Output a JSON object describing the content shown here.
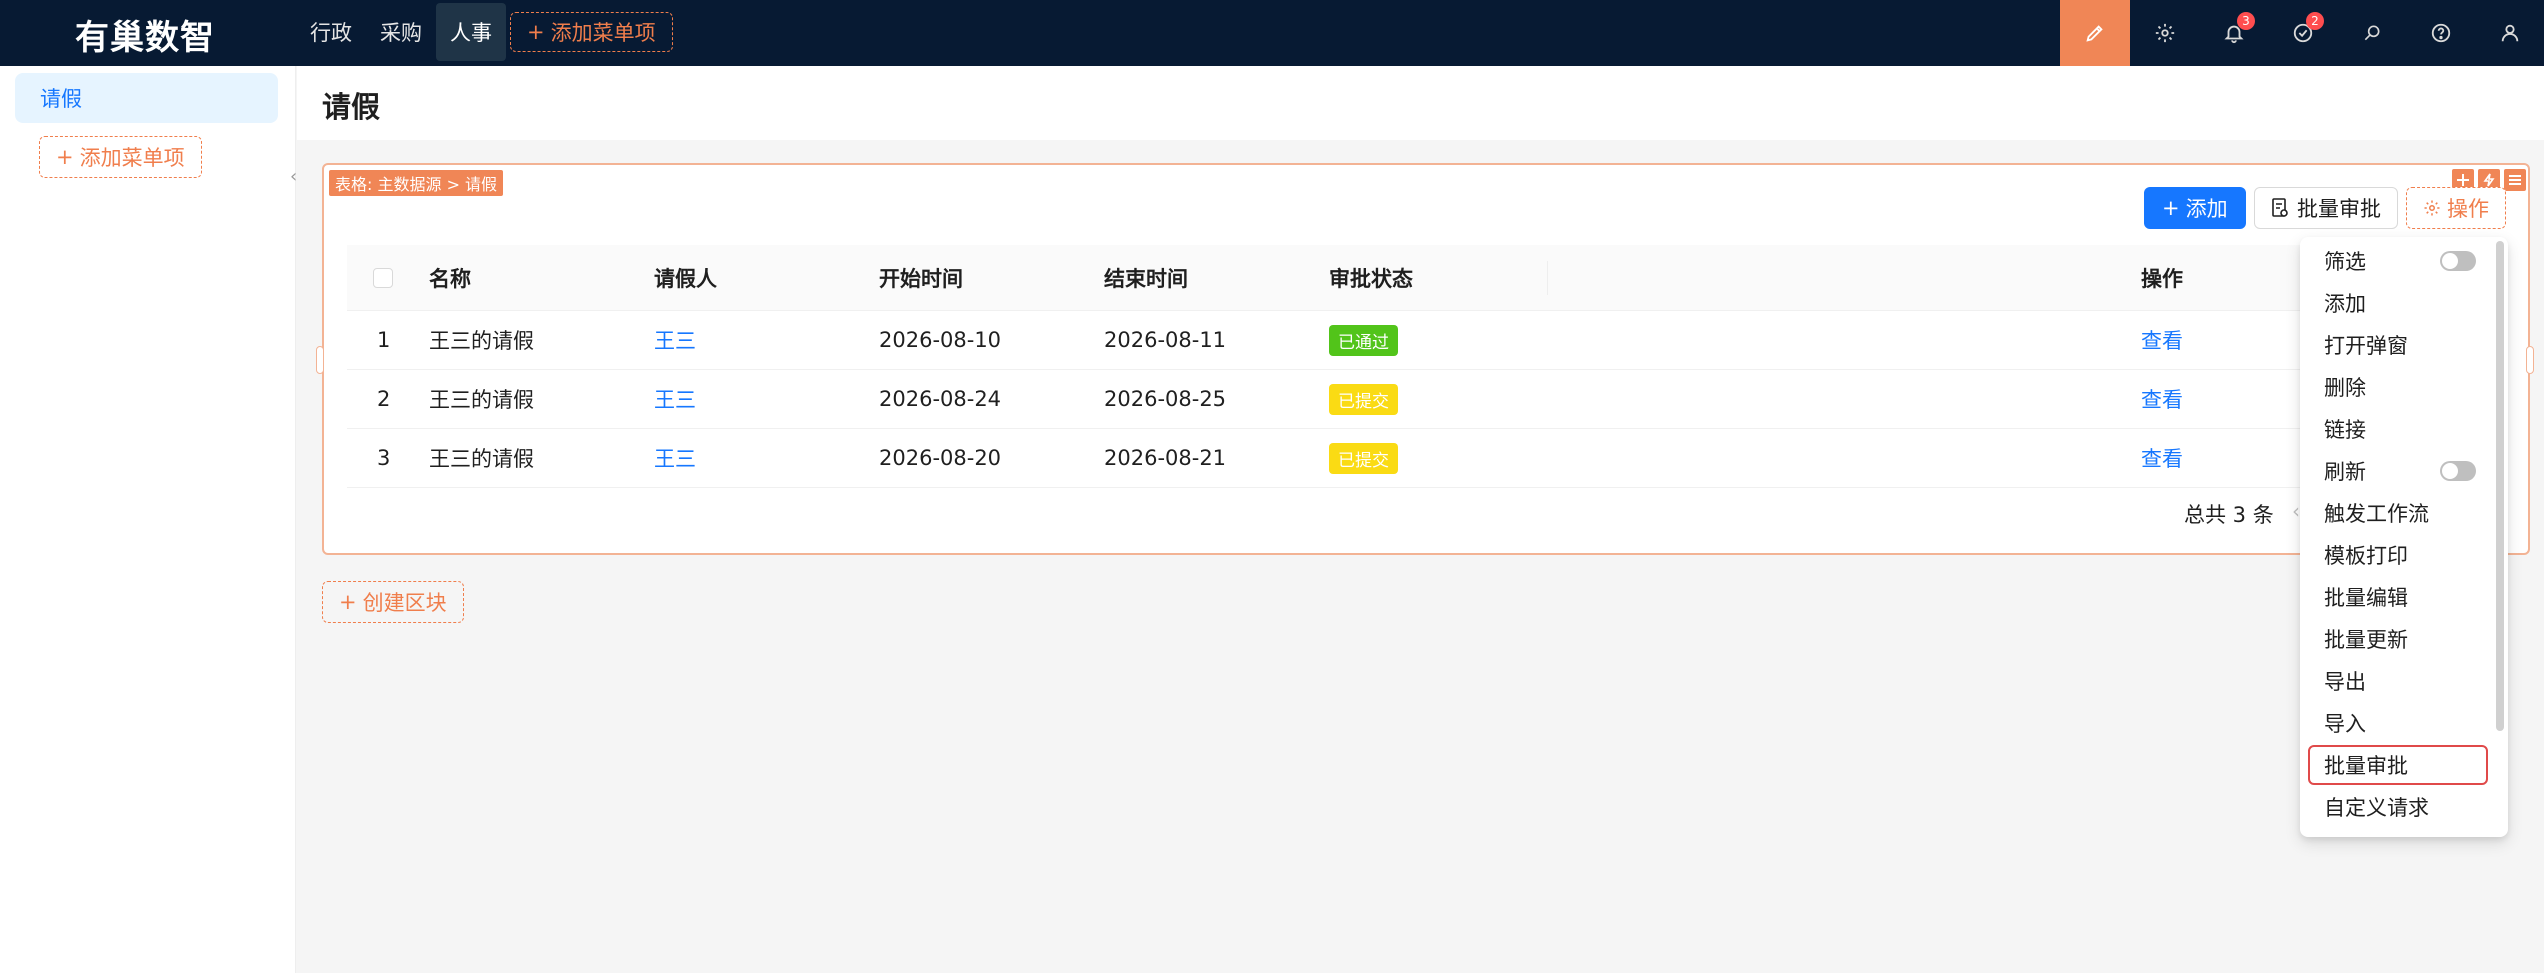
{
  "app": {
    "logo": "有巢数智"
  },
  "topnav": {
    "items": [
      {
        "label": "行政"
      },
      {
        "label": "采购"
      },
      {
        "label": "人事",
        "active": true
      }
    ],
    "add_menu": "添加菜单项"
  },
  "top_actions": {
    "notifications_badge": "3",
    "tasks_badge": "2"
  },
  "sidebar": {
    "items": [
      {
        "label": "请假",
        "active": true
      }
    ],
    "add_menu": "添加菜单项"
  },
  "page": {
    "title": "请假"
  },
  "block": {
    "tag": "表格: 主数据源 > 请假",
    "add_button": "添加",
    "batch_button": "批量审批",
    "ops_button": "操作"
  },
  "table": {
    "columns": [
      "名称",
      "请假人",
      "开始时间",
      "结束时间",
      "审批状态",
      "操作"
    ],
    "rows": [
      {
        "index": "1",
        "name": "王三的请假",
        "person": "王三",
        "start": "2026-08-10",
        "end": "2026-08-11",
        "status": "已通过",
        "status_color": "#52c41a",
        "action": "查看"
      },
      {
        "index": "2",
        "name": "王三的请假",
        "person": "王三",
        "start": "2026-08-24",
        "end": "2026-08-25",
        "status": "已提交",
        "status_color": "#fadb14",
        "action": "查看"
      },
      {
        "index": "3",
        "name": "王三的请假",
        "person": "王三",
        "start": "2026-08-20",
        "end": "2026-08-21",
        "status": "已提交",
        "status_color": "#fadb14",
        "action": "查看"
      }
    ],
    "total": "总共 3 条"
  },
  "create_block": "创建区块",
  "dropdown": {
    "items": [
      {
        "label": "筛选",
        "toggle": true
      },
      {
        "label": "添加"
      },
      {
        "label": "打开弹窗"
      },
      {
        "label": "删除"
      },
      {
        "label": "链接"
      },
      {
        "label": "刷新",
        "toggle": true
      },
      {
        "label": "触发工作流"
      },
      {
        "label": "模板打印"
      },
      {
        "label": "批量编辑"
      },
      {
        "label": "批量更新"
      },
      {
        "label": "导出"
      },
      {
        "label": "导入"
      },
      {
        "label": "批量审批",
        "selected": true
      },
      {
        "label": "自定义请求"
      }
    ]
  },
  "colors": {
    "topbar": "#071a33",
    "accent": "#f08656",
    "primary": "#1677ff"
  }
}
